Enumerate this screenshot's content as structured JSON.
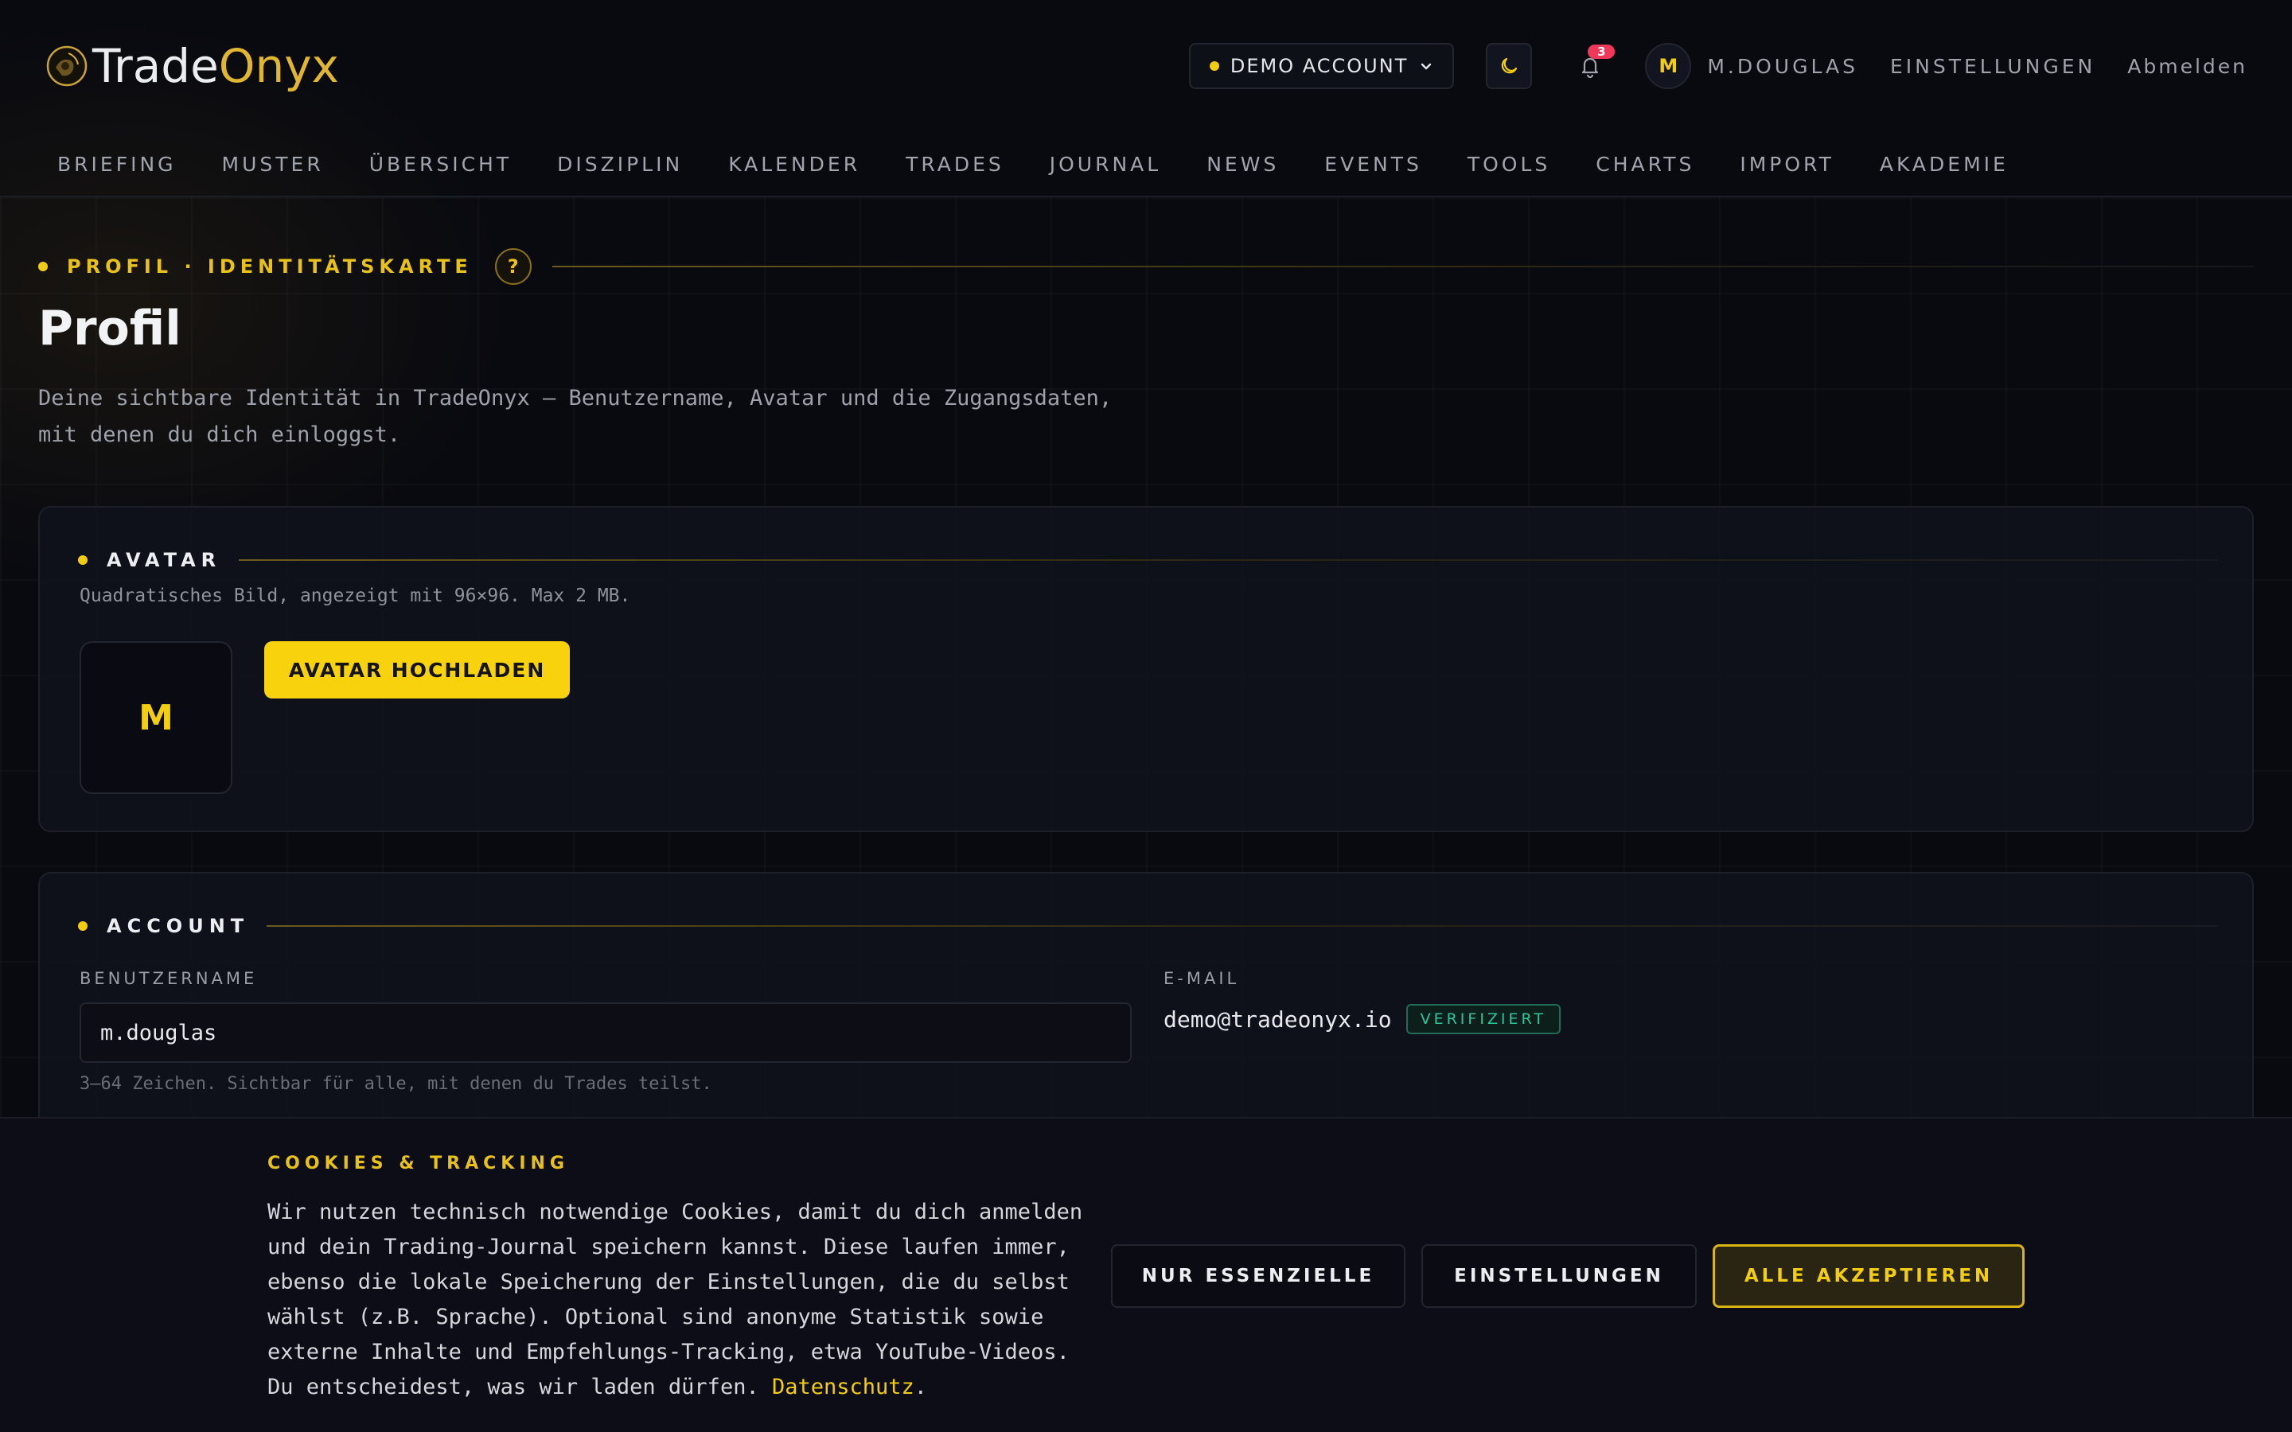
{
  "brand": {
    "part1": "Trade",
    "part2": "Onyx"
  },
  "header": {
    "account_label": "DEMO ACCOUNT",
    "notifications_count": "3",
    "user_initial": "M",
    "username": "M.DOUGLAS",
    "settings_label": "EINSTELLUNGEN",
    "logout_label": "Abmelden"
  },
  "nav": {
    "items": [
      "BRIEFING",
      "MUSTER",
      "ÜBERSICHT",
      "DISZIPLIN",
      "KALENDER",
      "TRADES",
      "JOURNAL",
      "NEWS",
      "EVENTS",
      "TOOLS",
      "CHARTS",
      "IMPORT",
      "AKADEMIE"
    ]
  },
  "page": {
    "eyebrow": "PROFIL · IDENTITÄTSKARTE",
    "help": "?",
    "title": "Profil",
    "description": "Deine sichtbare Identität in TradeOnyx — Benutzername, Avatar und die Zugangsdaten, mit denen du dich einloggst."
  },
  "avatar_card": {
    "heading": "AVATAR",
    "subtitle": "Quadratisches Bild, angezeigt mit 96×96. Max 2 MB.",
    "initial": "M",
    "upload_label": "AVATAR HOCHLADEN"
  },
  "account_card": {
    "heading": "ACCOUNT",
    "username_label": "BENUTZERNAME",
    "username_value": "m.douglas",
    "username_hint": "3–64 Zeichen. Sichtbar für alle, mit denen du Trades teilst.",
    "email_label": "E-MAIL",
    "email_value": "demo@tradeonyx.io",
    "verified_label": "VERIFIZIERT"
  },
  "cookie_banner": {
    "title": "COOKIES & TRACKING",
    "text": "Wir nutzen technisch notwendige Cookies, damit du dich anmelden und dein Trading-Journal speichern kannst. Diese laufen immer, ebenso die lokale Speicherung der Einstellungen, die du selbst wählst (z.B. Sprache). Optional sind anonyme Statistik sowie externe Inhalte und Empfehlungs-Tracking, etwa YouTube-Videos. Du entscheidest, was wir laden dürfen.",
    "link": "Datenschutz",
    "link_suffix": ".",
    "essential_label": "NUR ESSENZIELLE",
    "settings_label": "EINSTELLUNGEN",
    "accept_label": "ALLE AKZEPTIEREN"
  },
  "colors": {
    "accent": "#f3cd12",
    "background": "#090a10",
    "verified": "#2fc59a",
    "badge": "#f0395a"
  },
  "icons": {
    "logo": "globe-logo-icon",
    "theme": "moon-icon",
    "notifications": "bell-icon",
    "dropdown": "chevron-down-icon"
  }
}
